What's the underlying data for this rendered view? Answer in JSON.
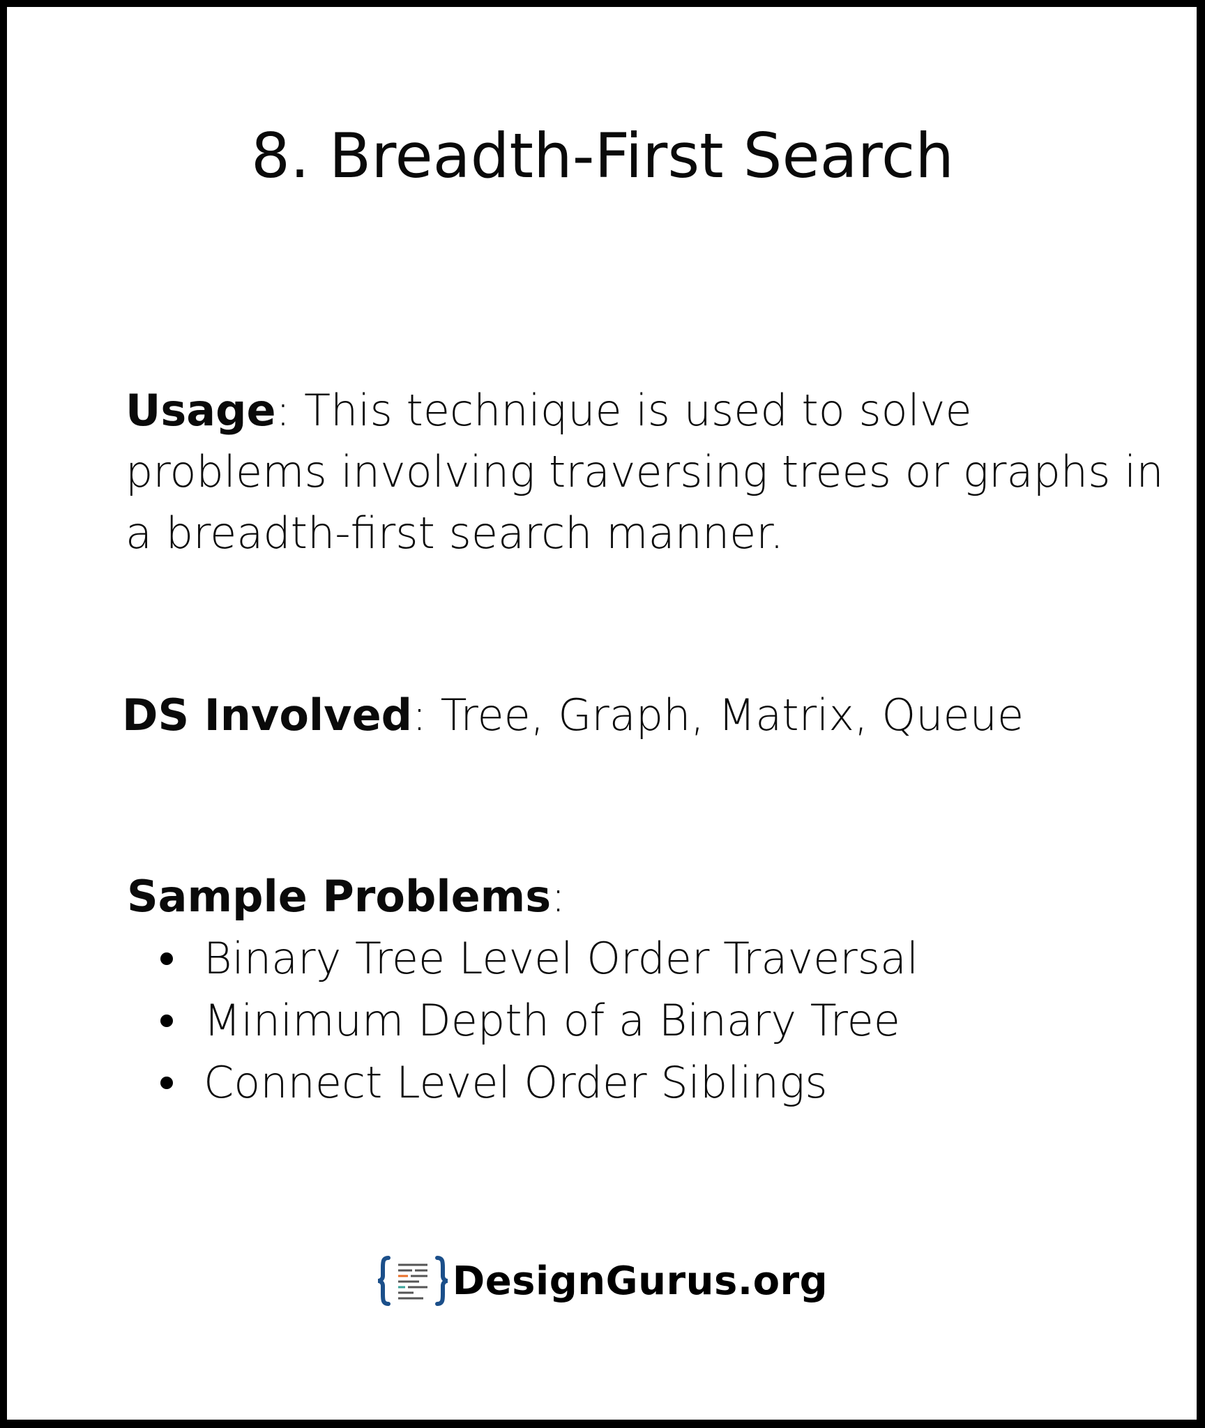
{
  "title": "8. Breadth-First Search",
  "usage": {
    "label": "Usage",
    "separator": ":",
    "lines": [
      " This technique is used to solve",
      "problems involving traversing trees or graphs in",
      "a breadth-first search manner."
    ]
  },
  "ds_involved": {
    "label": "DS Involved",
    "separator": ":",
    "text": " Tree, Graph, Matrix, Queue"
  },
  "sample_problems": {
    "label": "Sample Problems",
    "separator": ":",
    "items": [
      "Binary Tree Level Order Traversal",
      "Minimum Depth of a Binary Tree",
      "Connect Level Order Siblings"
    ]
  },
  "logo": {
    "icon": "code-brackets-logo-icon",
    "text": "DesignGurus.org",
    "colors": {
      "brackets": "#1b4f8a",
      "accent_orange": "#e8702a",
      "accent_teal": "#3aa39a",
      "lines": "#555555"
    }
  }
}
